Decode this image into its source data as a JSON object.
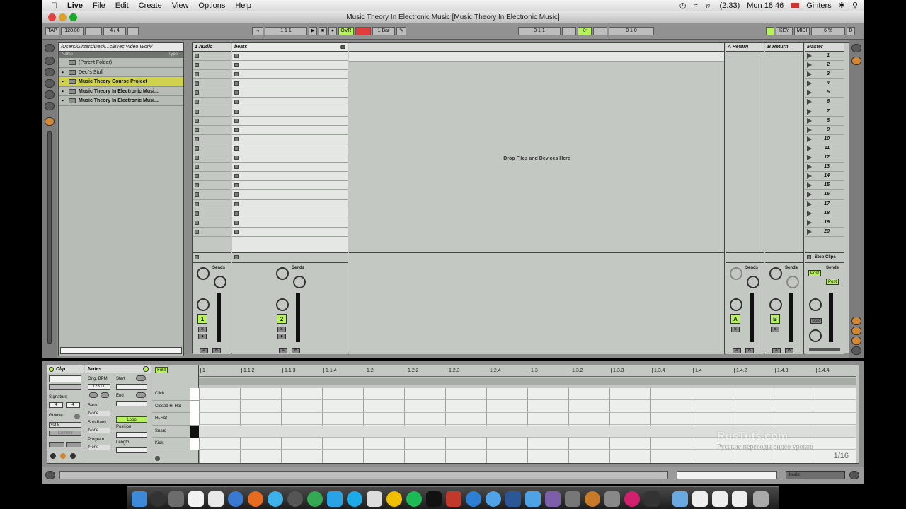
{
  "menubar": {
    "app": "Live",
    "items": [
      "File",
      "Edit",
      "Create",
      "View",
      "Options",
      "Help"
    ],
    "battery": "(2:33)",
    "clock": "Mon 18:46",
    "user": "Ginters"
  },
  "window_title": "Music Theory In Electronic Music  [Music Theory In Electronic Music]",
  "control": {
    "tap": "TAP",
    "bpm": "128.00",
    "sig": "4 / 4",
    "pos": "1    1    1",
    "ovr": "OVR",
    "quant": "1 Bar",
    "loop_start": "3    1    1",
    "loop_len": "0    1    0",
    "key": "KEY",
    "midi": "MIDI",
    "cpu": "6 %",
    "d": "D"
  },
  "browser": {
    "path": "/Users/Ginters/Desk...c/BTec Video Work/",
    "col_name": "Name",
    "col_type": "Type",
    "rows": [
      {
        "label": "(Parent Folder)",
        "selected": false
      },
      {
        "label": "Deci's Stuff",
        "selected": false
      },
      {
        "label": "Music Theory Course Project",
        "selected": true
      },
      {
        "label": "Music Theory In Electronic Musi...",
        "selected": false
      },
      {
        "label": "Music Theory In Electronic Musi...",
        "selected": false
      }
    ]
  },
  "session": {
    "tracks": [
      "1 Audio",
      "beats",
      "A Return",
      "B Return",
      "Master"
    ],
    "drop_text": "Drop Files and Devices Here",
    "scenes": [
      "1",
      "2",
      "3",
      "4",
      "5",
      "6",
      "7",
      "8",
      "9",
      "10",
      "11",
      "12",
      "13",
      "14",
      "15",
      "16",
      "17",
      "18",
      "19",
      "20"
    ],
    "stop_clips": "Stop Clips",
    "sends": "Sends",
    "post": "Post",
    "solo": "Solo",
    "track1_num": "1",
    "track2_num": "2",
    "ret_a": "A",
    "ret_b": "B",
    "s": "S",
    "ab_a": "A",
    "ab_b": "B"
  },
  "detail": {
    "clip_title": "Clip",
    "notes_title": "Notes",
    "fold": "Fold",
    "orig_bpm_label": "Orig. BPM",
    "orig_bpm": "128.00",
    "start_label": "Start",
    "end_label": "End",
    "signature_label": "Signature",
    "sig_num": "4",
    "sig_den": "4",
    "bank_label": "Bank",
    "bank_val": "None",
    "groove_label": "Groove",
    "groove_val": "None",
    "subbank_label": "Sub-Bank",
    "subbank_val": "None",
    "loop": "Loop",
    "position_label": "Position",
    "program_label": "Program",
    "program_val": "None",
    "length_label": "Length",
    "commit": "Commit",
    "lanes": [
      "Click",
      "Closed Hi Hat",
      "Hi-Hat",
      "Snare",
      "Kick"
    ],
    "ruler": [
      "1",
      "1.1.2",
      "1.1.3",
      "1.1.4",
      "1.2",
      "1.2.2",
      "1.2.3",
      "1.2.4",
      "1.3",
      "1.3.2",
      "1.3.3",
      "1.3.4",
      "1.4",
      "1.4.2",
      "1.4.3",
      "1.4.4"
    ],
    "grid": "1/16"
  },
  "watermark": {
    "brand": "RusTuts.com",
    "sub": "Русские переводы видео уроков"
  },
  "status": {
    "track_label": "beats"
  },
  "colors": {
    "accent_green": "#b6f25c",
    "selected_yellow": "#ced24f",
    "ovr_red": "#e23c3c"
  }
}
